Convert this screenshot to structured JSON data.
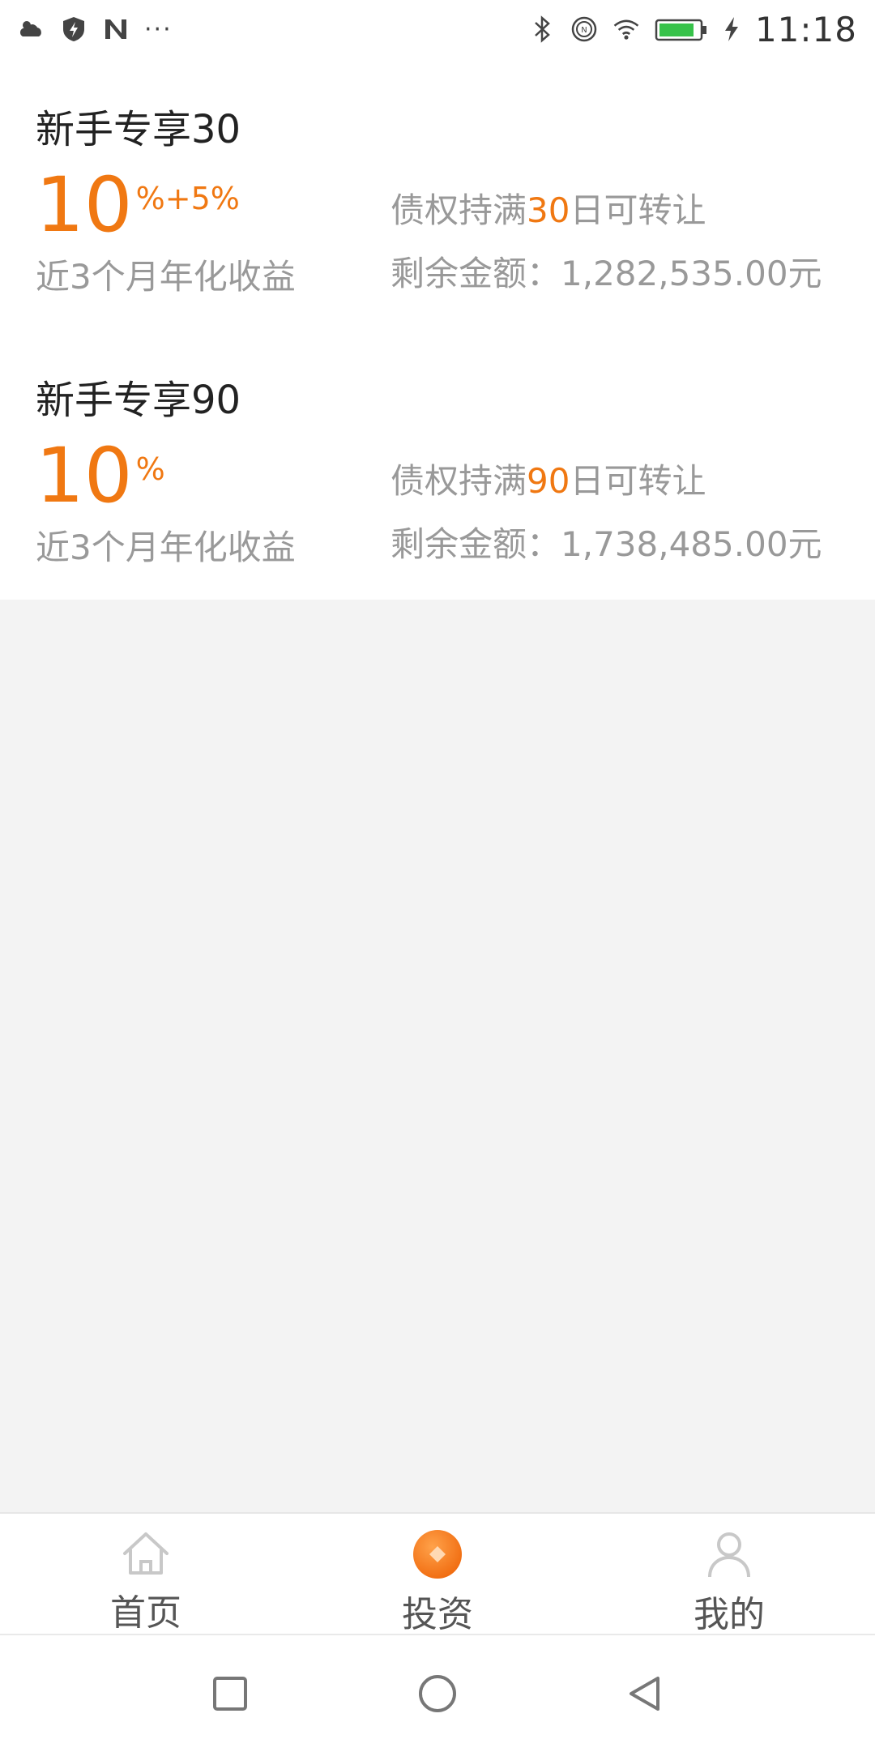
{
  "status_bar": {
    "time": "11:18",
    "left_icons": [
      "weather-icon",
      "shield-bolt-icon",
      "n-app-icon",
      "more-dots-icon"
    ],
    "more": "···",
    "right_icons": [
      "bluetooth-icon",
      "nfc-icon",
      "wifi-icon",
      "battery-icon",
      "charging-icon"
    ]
  },
  "products": [
    {
      "title": "新手专享30",
      "rate": "10",
      "rate_suffix": "%+5%",
      "rate_label": "近3个月年化收益",
      "transfer_prefix": "债权持满",
      "transfer_days": "30",
      "transfer_suffix": "日可转让",
      "remaining": "剩余金额：1,282,535.00元"
    },
    {
      "title": "新手专享90",
      "rate": "10",
      "rate_suffix": "%",
      "rate_label": "近3个月年化收益",
      "transfer_prefix": "债权持满",
      "transfer_days": "90",
      "transfer_suffix": "日可转让",
      "remaining": "剩余金额：1,738,485.00元"
    }
  ],
  "tabs": [
    {
      "label": "首页",
      "icon": "home-icon",
      "active": false
    },
    {
      "label": "投资",
      "icon": "invest-icon",
      "active": true
    },
    {
      "label": "我的",
      "icon": "profile-icon",
      "active": false
    }
  ],
  "colors": {
    "accent": "#f07812",
    "text_primary": "#222222",
    "text_secondary": "#999999",
    "background": "#f3f3f3"
  },
  "nav_bar": {
    "buttons": [
      "recent-apps-icon",
      "home-circle-icon",
      "back-icon"
    ]
  }
}
